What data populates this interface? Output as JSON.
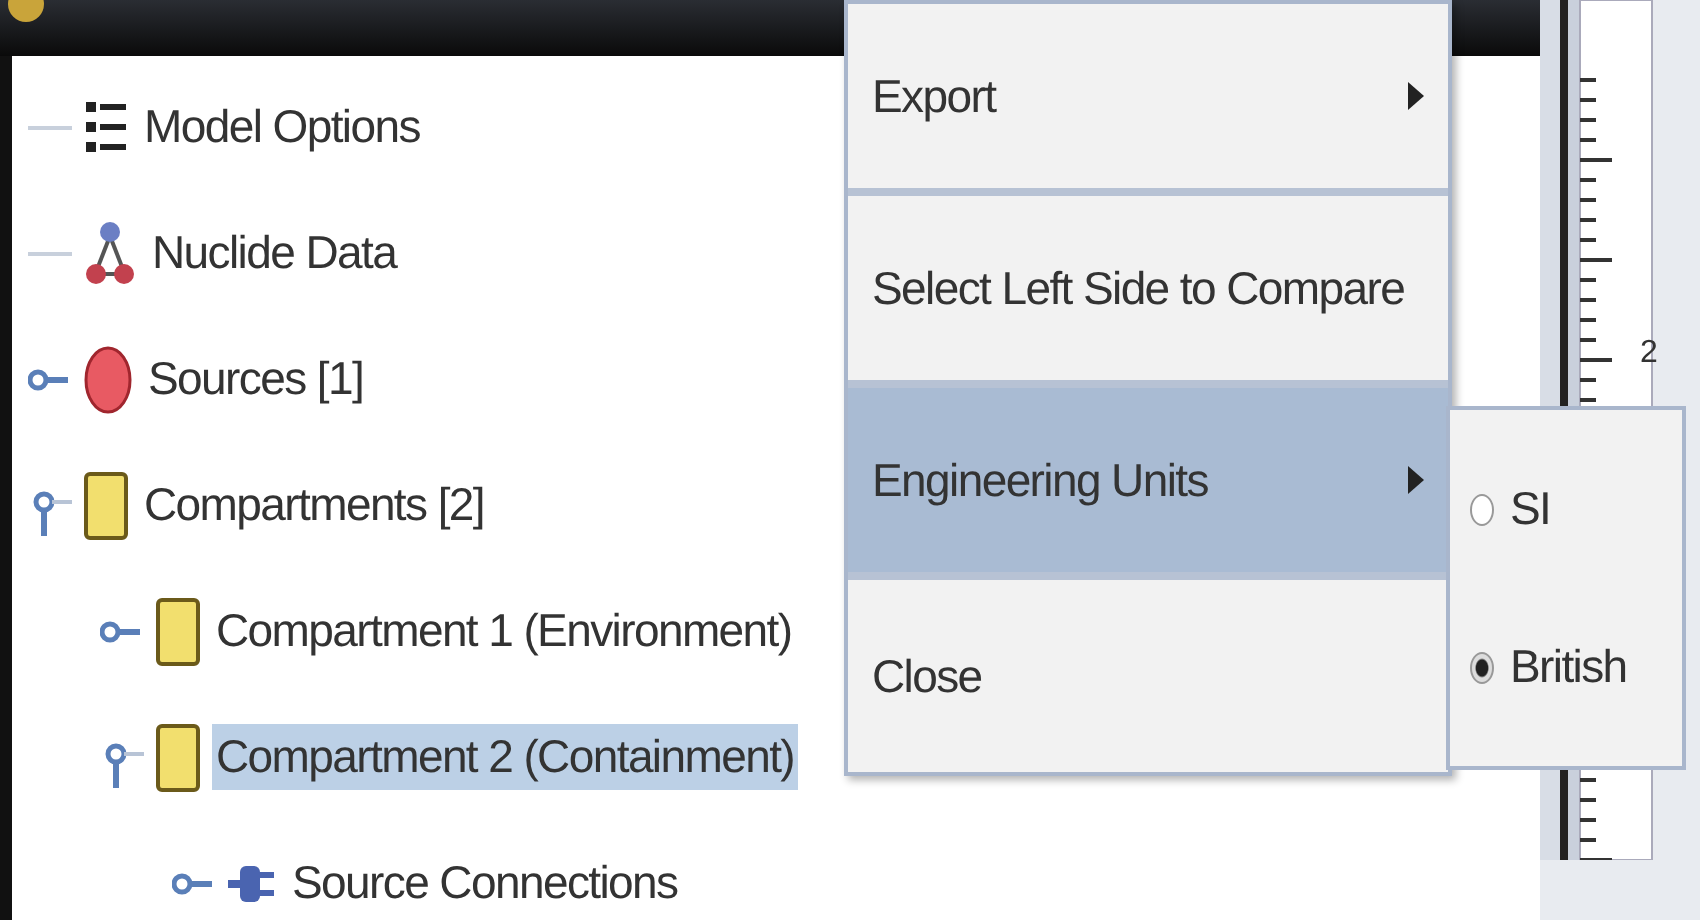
{
  "tree": [
    {
      "label": "Model Options",
      "kind": "options",
      "selected": false
    },
    {
      "label": "Nuclide Data",
      "kind": "nuclide",
      "selected": false
    },
    {
      "label": "Sources [1]",
      "kind": "source",
      "expanded": false,
      "selected": false
    },
    {
      "label": "Compartments [2]",
      "kind": "compartment",
      "expanded": true,
      "selected": false,
      "children": [
        {
          "label": "Compartment 1 (Environment)",
          "kind": "compartment",
          "expanded": false,
          "selected": false
        },
        {
          "label": "Compartment 2 (Containment)",
          "kind": "compartment",
          "expanded": true,
          "selected": true,
          "children": [
            {
              "label": "Source Connections",
              "kind": "connection",
              "expanded": false,
              "selected": false
            }
          ]
        }
      ]
    }
  ],
  "context_menu": {
    "items": [
      {
        "label": "Export",
        "submenu": true,
        "selected": false
      },
      {
        "label": "Select Left Side to Compare",
        "submenu": false,
        "selected": false
      },
      {
        "label": "Engineering Units",
        "submenu": true,
        "selected": true
      },
      {
        "label": "Close",
        "submenu": false,
        "selected": false
      }
    ]
  },
  "units_submenu": {
    "options": [
      {
        "label": "SI",
        "selected": false
      },
      {
        "label": "British",
        "selected": true
      }
    ]
  },
  "ruler_label": "2"
}
